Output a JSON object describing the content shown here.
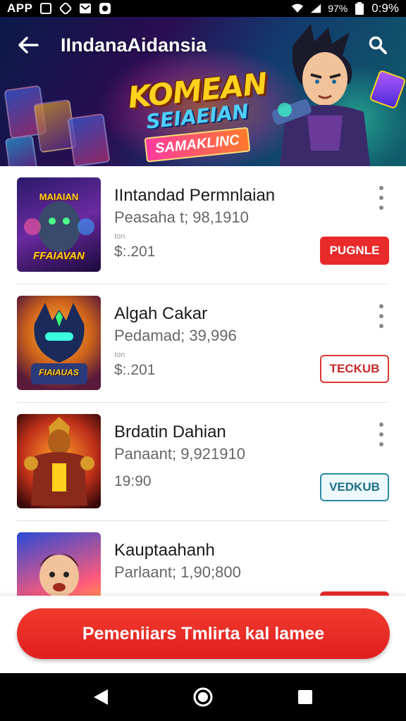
{
  "status_bar": {
    "app_name": "APP",
    "battery_percent": "97%",
    "time": "0:9%"
  },
  "header": {
    "title": "IIndanaAidansia",
    "banner": {
      "title": "KOMEAN",
      "subtitle": "SEIAEIAN",
      "ribbon": "SAMAKLINC"
    }
  },
  "items": [
    {
      "title": "IIntandad Permnlaian",
      "subtitle": "Peasaha t; 98,1910",
      "tag": "Ion",
      "price": "$:.201",
      "button_label": "PUGNLE",
      "button_style": "solid",
      "thumb_text_top": "MAIAIAN",
      "thumb_text_bottom": "FFAIAVAN"
    },
    {
      "title": "Algah Cakar",
      "subtitle": "Pedamad; 39,996",
      "tag": "Ion",
      "price": "$:.201",
      "button_label": "TECKUB",
      "button_style": "outline-red",
      "thumb_text_top": "",
      "thumb_text_bottom": "FIAIAUAS"
    },
    {
      "title": "Brdatin Dahian",
      "subtitle": "Panaant; 9,921910",
      "tag": "",
      "price": "19:90",
      "button_label": "VEDKUB",
      "button_style": "outline-teal",
      "thumb_text_top": "",
      "thumb_text_bottom": ""
    },
    {
      "title": "Kauptaahanh",
      "subtitle": "Parlaant; 1,90;800",
      "tag": "",
      "price": "",
      "button_label": "",
      "button_style": "solid",
      "thumb_text_top": "",
      "thumb_text_bottom": ""
    }
  ],
  "cta": {
    "label": "Pemeniiars Tmlirta kal lamee"
  },
  "colors": {
    "accent_red": "#e82a2a",
    "teal": "#2a8aa5",
    "header_bg": "#1a1a4a"
  },
  "icons": {
    "back": "arrow-left-icon",
    "search": "search-icon",
    "more": "more-vertical-icon",
    "nav_back": "triangle-back-icon",
    "nav_home": "circle-home-icon",
    "nav_recents": "square-recents-icon"
  }
}
